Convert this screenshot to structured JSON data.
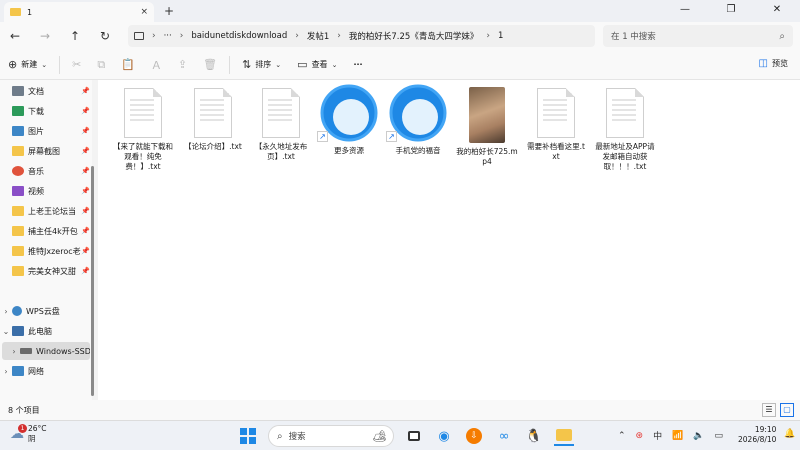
{
  "window": {
    "tab_title": "1",
    "tab_close": "×",
    "new_tab": "+",
    "controls": {
      "minimize": "—",
      "maximize": "❐",
      "close": "✕"
    }
  },
  "address": {
    "nav": {
      "back": "←",
      "forward": "→",
      "up": "↑",
      "refresh": "↻",
      "more": "···"
    },
    "crumbs": [
      "baidunetdiskdownload",
      "发帖1",
      "我的柏好长7.25《青岛大四学妹》",
      "1"
    ],
    "search_placeholder": "在 1 中搜索"
  },
  "commandbar": {
    "new_label": "新建",
    "sort_label": "排序",
    "view_label": "查看",
    "more": "···",
    "preview_label": "预览"
  },
  "sidebar": {
    "items": [
      {
        "label": "文档",
        "color": "#6f7c8a"
      },
      {
        "label": "下载",
        "color": "#2c9a5a"
      },
      {
        "label": "图片",
        "color": "#3d86c6"
      },
      {
        "label": "屏幕截图",
        "color": "#f4c54a"
      },
      {
        "label": "音乐",
        "color": "#e0533c"
      },
      {
        "label": "视频",
        "color": "#8a4fc7"
      },
      {
        "label": "上老王论坛当",
        "color": "#f4c54a"
      },
      {
        "label": "捕主任4k开包",
        "color": "#f4c54a"
      },
      {
        "label": "推特Jxzeroc老",
        "color": "#f4c54a"
      },
      {
        "label": "完美女神又甜",
        "color": "#f4c54a"
      }
    ],
    "groups": [
      {
        "label": "WPS云盘"
      },
      {
        "label": "此电脑"
      },
      {
        "label": "Windows-SSD"
      },
      {
        "label": "网络"
      }
    ]
  },
  "files": [
    {
      "label": "【来了就能下载和观看！纯免费！】.txt",
      "kind": "txt"
    },
    {
      "label": "【论坛介绍】.txt",
      "kind": "txt"
    },
    {
      "label": "【永久地址发布页】.txt",
      "kind": "txt"
    },
    {
      "label": "更多资源",
      "kind": "shortcut"
    },
    {
      "label": "手机党的福音",
      "kind": "shortcut"
    },
    {
      "label": "我的柏好长725.mp4",
      "kind": "video"
    },
    {
      "label": "需要补档看这里.txt",
      "kind": "txt"
    },
    {
      "label": "最新地址及APP请发邮箱自动获取！！！.txt",
      "kind": "txt"
    }
  ],
  "status": {
    "item_count": "8 个项目"
  },
  "taskbar": {
    "weather_temp": "26°C",
    "weather_desc": "阴",
    "weather_badge": "1",
    "search_label": "搜索",
    "clock_time": "19:10",
    "clock_date": "2026/8/10"
  }
}
